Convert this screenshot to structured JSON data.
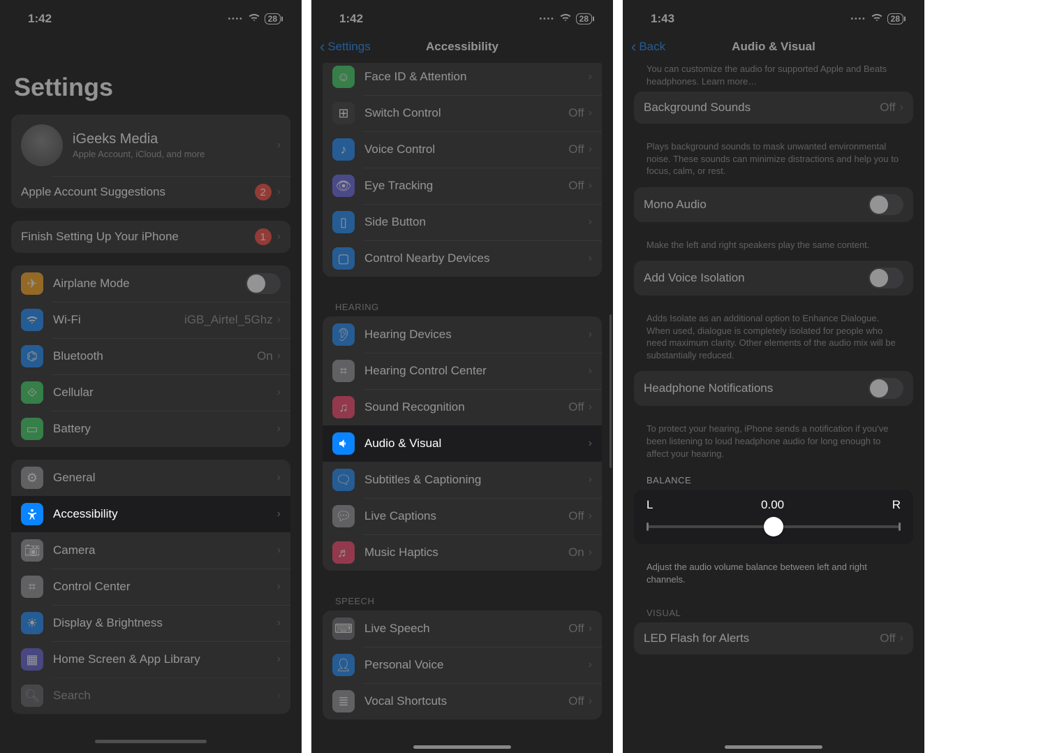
{
  "screen1": {
    "time": "1:42",
    "battery": "28",
    "title": "Settings",
    "profile": {
      "name": "iGeeks Media",
      "sub": "Apple Account, iCloud, and more"
    },
    "suggestions": {
      "label": "Apple Account Suggestions",
      "badge": "2"
    },
    "finish": {
      "label": "Finish Setting Up Your iPhone",
      "badge": "1"
    },
    "group_connectivity": [
      {
        "label": "Airplane Mode",
        "type": "toggle",
        "color": "#ff9f0a"
      },
      {
        "label": "Wi-Fi",
        "value": "iGB_Airtel_5Ghz",
        "color": "#0a84ff"
      },
      {
        "label": "Bluetooth",
        "value": "On",
        "color": "#0a84ff"
      },
      {
        "label": "Cellular",
        "color": "#30d158"
      },
      {
        "label": "Battery",
        "color": "#30d158"
      }
    ],
    "group_general": [
      {
        "label": "General",
        "color": "#8e8e93"
      },
      {
        "label": "Accessibility",
        "color": "#0a84ff",
        "highlight": true
      },
      {
        "label": "Camera",
        "color": "#8e8e93"
      },
      {
        "label": "Control Center",
        "color": "#8e8e93"
      },
      {
        "label": "Display & Brightness",
        "color": "#0a84ff"
      },
      {
        "label": "Home Screen & App Library",
        "color": "#5856d6"
      },
      {
        "label": "Search",
        "color": "#8e8e93"
      }
    ]
  },
  "screen2": {
    "time": "1:42",
    "battery": "28",
    "back": "Settings",
    "title": "Accessibility",
    "group_top": [
      {
        "label": "Face ID & Attention",
        "color": "#30d158"
      },
      {
        "label": "Switch Control",
        "value": "Off",
        "color": "#5e5ce6"
      },
      {
        "label": "Voice Control",
        "value": "Off",
        "color": "#0a84ff"
      },
      {
        "label": "Eye Tracking",
        "value": "Off",
        "color": "#5e5ce6"
      },
      {
        "label": "Side Button",
        "color": "#0a84ff"
      },
      {
        "label": "Control Nearby Devices",
        "color": "#0a84ff"
      }
    ],
    "hearing_header": "HEARING",
    "group_hearing": [
      {
        "label": "Hearing Devices",
        "color": "#0a84ff"
      },
      {
        "label": "Hearing Control Center",
        "color": "#8e8e93"
      },
      {
        "label": "Sound Recognition",
        "value": "Off",
        "color": "#ff375f"
      },
      {
        "label": "Audio & Visual",
        "color": "#0a84ff",
        "highlight": true
      },
      {
        "label": "Subtitles & Captioning",
        "color": "#0a84ff"
      },
      {
        "label": "Live Captions",
        "value": "Off",
        "color": "#8e8e93"
      },
      {
        "label": "Music Haptics",
        "value": "On",
        "color": "#ff375f"
      }
    ],
    "speech_header": "SPEECH",
    "group_speech": [
      {
        "label": "Live Speech",
        "value": "Off",
        "color": "#636366"
      },
      {
        "label": "Personal Voice",
        "color": "#0a84ff"
      },
      {
        "label": "Vocal Shortcuts",
        "value": "Off",
        "color": "#8e8e93"
      }
    ]
  },
  "screen3": {
    "time": "1:43",
    "battery": "28",
    "back": "Back",
    "title": "Audio & Visual",
    "top_footer_part": "You can customize the audio for supported Apple and Beats headphones.",
    "top_footer_link": "Learn more…",
    "bg_sounds": {
      "label": "Background Sounds",
      "value": "Off"
    },
    "bg_sounds_footer": "Plays background sounds to mask unwanted environmental noise. These sounds can minimize distractions and help you to focus, calm, or rest.",
    "mono": {
      "label": "Mono Audio"
    },
    "mono_footer": "Make the left and right speakers play the same content.",
    "voice_iso": {
      "label": "Add Voice Isolation"
    },
    "voice_iso_footer": "Adds Isolate as an additional option to Enhance Dialogue. When used, dialogue is completely isolated for people who need maximum clarity. Other elements of the audio mix will be substantially reduced.",
    "hp_notif": {
      "label": "Headphone Notifications"
    },
    "hp_notif_footer": "To protect your hearing, iPhone sends a notification if you've been listening to loud headphone audio for long enough to affect your hearing.",
    "balance_header": "BALANCE",
    "balance": {
      "left": "L",
      "right": "R",
      "value": "0.00"
    },
    "balance_footer": "Adjust the audio volume balance between left and right channels.",
    "visual_header": "VISUAL",
    "led": {
      "label": "LED Flash for Alerts",
      "value": "Off"
    }
  }
}
